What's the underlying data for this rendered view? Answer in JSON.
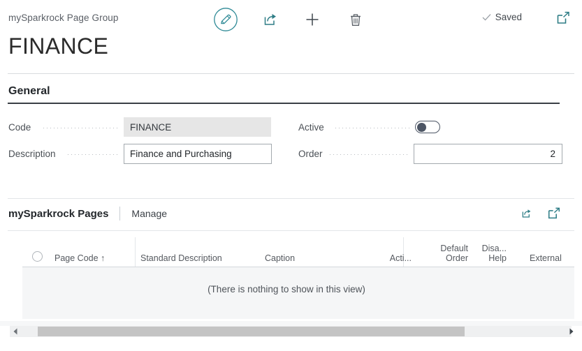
{
  "header": {
    "breadcrumb": "mySparkrock Page Group",
    "page_title": "FINANCE",
    "status_text": "Saved",
    "icons": {
      "edit": "pencil-edit-icon",
      "share": "share-icon",
      "add": "plus-icon",
      "delete": "trash-icon",
      "checkmark": "check-icon",
      "open_in_new": "open-in-new-window-icon"
    },
    "accent_color": "#2e8a96"
  },
  "general": {
    "section_title": "General",
    "fields": {
      "code": {
        "label": "Code",
        "value": "FINANCE",
        "readonly": true
      },
      "description": {
        "label": "Description",
        "value": "Finance and Purchasing",
        "readonly": false
      },
      "active": {
        "label": "Active",
        "value": "off",
        "checked": false
      },
      "order": {
        "label": "Order",
        "value": "2",
        "readonly": false
      }
    }
  },
  "subpage": {
    "title": "mySparkrock Pages",
    "tabs": [
      "Manage"
    ],
    "icons": {
      "share": "share-icon",
      "expand": "open-in-new-window-icon"
    },
    "table": {
      "columns": [
        {
          "label": "Page Code",
          "sort": "↑",
          "align": "left"
        },
        {
          "label": "Standard Description",
          "align": "left"
        },
        {
          "label": "Caption",
          "align": "left"
        },
        {
          "label": "Acti...",
          "align": "right"
        },
        {
          "label": "Default",
          "label2": "Order",
          "align": "right"
        },
        {
          "label": "Disa...",
          "label2": "Help",
          "align": "right"
        },
        {
          "label": "External",
          "align": "left"
        }
      ],
      "rows": [],
      "empty_message": "(There is nothing to show in this view)"
    }
  },
  "scrollbar": {
    "left_arrow": "triangle-left-icon",
    "right_arrow": "triangle-right-icon",
    "orientation": "horizontal"
  }
}
